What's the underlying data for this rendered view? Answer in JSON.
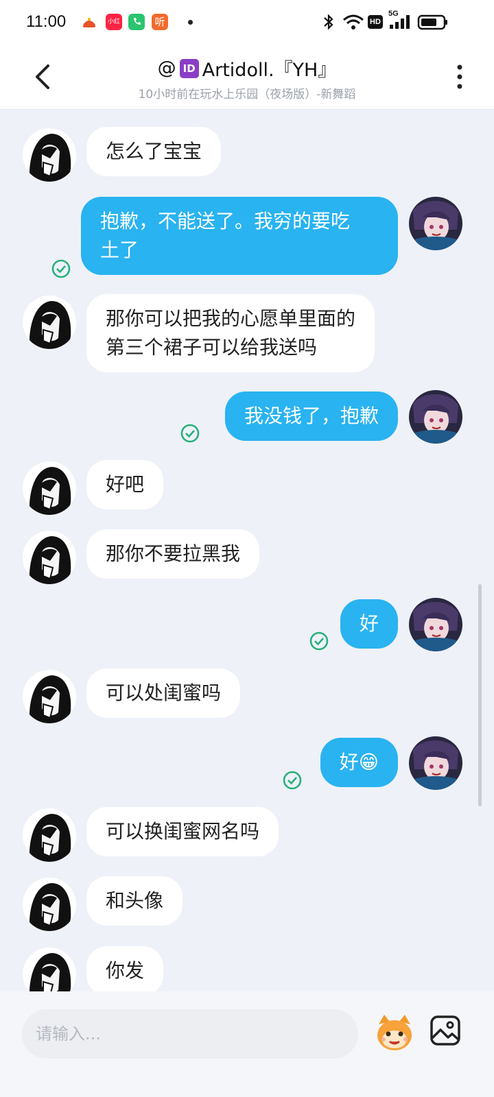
{
  "status_bar": {
    "time": "11:00",
    "apps": [
      "小红书",
      "电话",
      "听"
    ],
    "icons": [
      "bluetooth-icon",
      "wifi-icon",
      "hd-icon",
      "5g-signal-icon",
      "battery-icon"
    ],
    "signal_label": "5G",
    "hd_label": "HD"
  },
  "header": {
    "title_prefix": "@",
    "title_badge": "ID",
    "title_name": "Artidoll.『YH』",
    "subtitle": "10小时前在玩水上乐园（夜场版）-新舞蹈"
  },
  "messages": [
    {
      "side": "left",
      "text": "怎么了宝宝"
    },
    {
      "side": "right",
      "text": "抱歉，不能送了。我穷的要吃\n土了",
      "read": true
    },
    {
      "side": "left",
      "text": "那你可以把我的心愿单里面的\n第三个裙子可以给我送吗"
    },
    {
      "side": "right",
      "text": "我没钱了，抱歉",
      "read": true
    },
    {
      "side": "left",
      "text": "好吧"
    },
    {
      "side": "left",
      "text": "那你不要拉黑我"
    },
    {
      "side": "right",
      "text": "好",
      "read": true
    },
    {
      "side": "left",
      "text": "可以处闺蜜吗"
    },
    {
      "side": "right",
      "text": "好😁",
      "read": true
    },
    {
      "side": "left",
      "text": "可以换闺蜜网名吗"
    },
    {
      "side": "left",
      "text": "和头像"
    },
    {
      "side": "left",
      "text": "你发"
    }
  ],
  "input": {
    "placeholder": "请输入..."
  },
  "colors": {
    "accent": "#29b3f0",
    "read_check": "#27b07a",
    "background": "#eef1f8"
  }
}
